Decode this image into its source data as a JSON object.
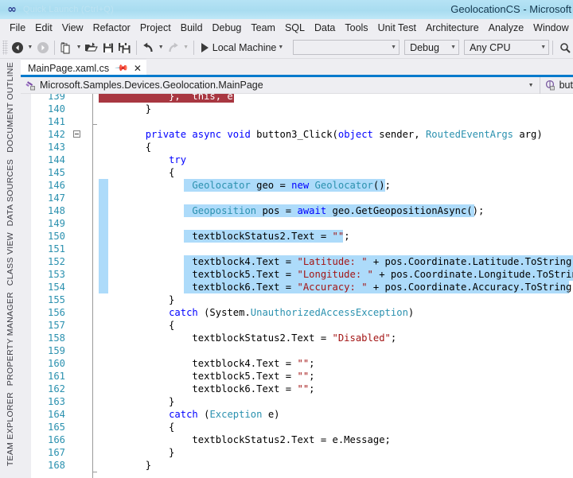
{
  "window": {
    "title": "GeolocationCS - Microsoft",
    "logo_icon": "visual-studio-infinity-logo",
    "quick_launch_placeholder": "Quick Launch (Ctrl+Q)"
  },
  "menu": {
    "items": [
      "File",
      "Edit",
      "View",
      "Refactor",
      "Project",
      "Build",
      "Debug",
      "Team",
      "SQL",
      "Data",
      "Tools",
      "Unit Test",
      "Architecture",
      "Analyze",
      "Window"
    ]
  },
  "toolbar": {
    "icons": [
      "navigate-back-icon",
      "navigate-forward-icon",
      "new-item-icon",
      "open-file-icon",
      "save-icon",
      "save-all-icon",
      "undo-icon",
      "redo-icon"
    ],
    "run_label": "Local Machine",
    "run_icon": "play-icon",
    "target_device_value": "",
    "configuration_value": "Debug",
    "platform_value": "Any CPU",
    "find_icon": "find-in-files-icon"
  },
  "left_rail": {
    "tabs": [
      "DOCUMENT OUTLINE",
      "DATA SOURCES",
      "CLASS VIEW",
      "PROPERTY MANAGER",
      "TEAM EXPLORER"
    ]
  },
  "document_tab": {
    "label": "MainPage.xaml.cs",
    "pin_icon": "pin-icon",
    "close_icon": "close-icon"
  },
  "navbar": {
    "type_icon": "class-members-icon",
    "type_value": "Microsoft.Samples.Devices.Geolocation.MainPage",
    "member_icon": "method-icon",
    "member_value": "but",
    "caret_icon": "chevron-down-icon"
  },
  "colors": {
    "accent": "#007acc",
    "selection": "#addbfa",
    "breakpoint_line": "#a83741",
    "line_number": "#2b91af",
    "keyword": "#0000ff",
    "type": "#2b91af",
    "string": "#a31515",
    "titlebar": "#a8dcf0",
    "chrome": "#eeeef2"
  },
  "editor": {
    "first_line": 139,
    "lines": [
      {
        "n": 139,
        "sel": "red",
        "redx": 98,
        "redw": 170,
        "tokens": [
          {
            "t": "            },  this, e);",
            "c": "redtext"
          }
        ]
      },
      {
        "n": 140,
        "tokens": [
          {
            "t": "        }",
            "c": "pln"
          }
        ]
      },
      {
        "n": 141,
        "tokens": [
          {
            "t": "",
            "c": "pln"
          }
        ]
      },
      {
        "n": 142,
        "collapse": true,
        "tokens": [
          {
            "t": "        ",
            "c": "pln"
          },
          {
            "t": "private",
            "c": "kw"
          },
          {
            "t": " ",
            "c": "pln"
          },
          {
            "t": "async",
            "c": "kw"
          },
          {
            "t": " ",
            "c": "pln"
          },
          {
            "t": "void",
            "c": "kw"
          },
          {
            "t": " button3_Click(",
            "c": "pln"
          },
          {
            "t": "object",
            "c": "kw"
          },
          {
            "t": " sender, ",
            "c": "pln"
          },
          {
            "t": "RoutedEventArgs",
            "c": "typ"
          },
          {
            "t": " arg)",
            "c": "pln"
          }
        ]
      },
      {
        "n": 143,
        "tokens": [
          {
            "t": "        {",
            "c": "pln"
          }
        ]
      },
      {
        "n": 144,
        "tokens": [
          {
            "t": "            ",
            "c": "pln"
          },
          {
            "t": "try",
            "c": "kw"
          }
        ]
      },
      {
        "n": 145,
        "tokens": [
          {
            "t": "            {",
            "c": "pln"
          }
        ]
      },
      {
        "n": 146,
        "sel": "part",
        "selx": 205,
        "selw": 253,
        "tokens": [
          {
            "t": "                ",
            "c": "pln"
          },
          {
            "t": "Geolocator",
            "c": "typ"
          },
          {
            "t": " geo = ",
            "c": "pln"
          },
          {
            "t": "new",
            "c": "kw"
          },
          {
            "t": " ",
            "c": "pln"
          },
          {
            "t": "Geolocator",
            "c": "typ"
          },
          {
            "t": "();",
            "c": "pln"
          }
        ]
      },
      {
        "n": 147,
        "sel": "margin",
        "tokens": [
          {
            "t": "",
            "c": "pln"
          }
        ]
      },
      {
        "n": 148,
        "sel": "part",
        "selx": 205,
        "selw": 365,
        "tokens": [
          {
            "t": "                ",
            "c": "pln"
          },
          {
            "t": "Geoposition",
            "c": "typ"
          },
          {
            "t": " pos = ",
            "c": "pln"
          },
          {
            "t": "await",
            "c": "kw"
          },
          {
            "t": " geo.GetGeopositionAsync();",
            "c": "pln"
          }
        ]
      },
      {
        "n": 149,
        "sel": "margin",
        "tokens": [
          {
            "t": "",
            "c": "pln"
          }
        ]
      },
      {
        "n": 150,
        "sel": "part",
        "selx": 205,
        "selw": 200,
        "tokens": [
          {
            "t": "                textblockStatus2.Text = ",
            "c": "pln"
          },
          {
            "t": "\"\"",
            "c": "str"
          },
          {
            "t": ";",
            "c": "pln"
          }
        ]
      },
      {
        "n": 151,
        "sel": "margin",
        "tokens": [
          {
            "t": "",
            "c": "pln"
          }
        ]
      },
      {
        "n": 152,
        "sel": "part",
        "selx": 205,
        "selw": 507,
        "tokens": [
          {
            "t": "                textblock4.Text = ",
            "c": "pln"
          },
          {
            "t": "\"Latitude: \"",
            "c": "str"
          },
          {
            "t": " + pos.Coordinate.Latitude.ToString();",
            "c": "pln"
          }
        ]
      },
      {
        "n": 153,
        "sel": "part",
        "selx": 205,
        "selw": 514,
        "tokens": [
          {
            "t": "                textblock5.Text = ",
            "c": "pln"
          },
          {
            "t": "\"Longitude: \"",
            "c": "str"
          },
          {
            "t": " + pos.Coordinate.Longitude.ToString();",
            "c": "pln"
          }
        ]
      },
      {
        "n": 154,
        "sel": "part",
        "selx": 205,
        "selw": 484,
        "tokens": [
          {
            "t": "                textblock6.Text = ",
            "c": "pln"
          },
          {
            "t": "\"Accuracy: \"",
            "c": "str"
          },
          {
            "t": " + pos.Coordinate.Accuracy.ToString();",
            "c": "pln"
          }
        ]
      },
      {
        "n": 155,
        "tokens": [
          {
            "t": "            }",
            "c": "pln"
          }
        ]
      },
      {
        "n": 156,
        "tokens": [
          {
            "t": "            ",
            "c": "pln"
          },
          {
            "t": "catch",
            "c": "kw"
          },
          {
            "t": " (System.",
            "c": "pln"
          },
          {
            "t": "UnauthorizedAccessException",
            "c": "typ"
          },
          {
            "t": ")",
            "c": "pln"
          }
        ]
      },
      {
        "n": 157,
        "tokens": [
          {
            "t": "            {",
            "c": "pln"
          }
        ]
      },
      {
        "n": 158,
        "tokens": [
          {
            "t": "                textblockStatus2.Text = ",
            "c": "pln"
          },
          {
            "t": "\"Disabled\"",
            "c": "str"
          },
          {
            "t": ";",
            "c": "pln"
          }
        ]
      },
      {
        "n": 159,
        "tokens": [
          {
            "t": "",
            "c": "pln"
          }
        ]
      },
      {
        "n": 160,
        "tokens": [
          {
            "t": "                textblock4.Text = ",
            "c": "pln"
          },
          {
            "t": "\"\"",
            "c": "str"
          },
          {
            "t": ";",
            "c": "pln"
          }
        ]
      },
      {
        "n": 161,
        "tokens": [
          {
            "t": "                textblock5.Text = ",
            "c": "pln"
          },
          {
            "t": "\"\"",
            "c": "str"
          },
          {
            "t": ";",
            "c": "pln"
          }
        ]
      },
      {
        "n": 162,
        "tokens": [
          {
            "t": "                textblock6.Text = ",
            "c": "pln"
          },
          {
            "t": "\"\"",
            "c": "str"
          },
          {
            "t": ";",
            "c": "pln"
          }
        ]
      },
      {
        "n": 163,
        "tokens": [
          {
            "t": "            }",
            "c": "pln"
          }
        ]
      },
      {
        "n": 164,
        "tokens": [
          {
            "t": "            ",
            "c": "pln"
          },
          {
            "t": "catch",
            "c": "kw"
          },
          {
            "t": " (",
            "c": "pln"
          },
          {
            "t": "Exception",
            "c": "typ"
          },
          {
            "t": " e)",
            "c": "pln"
          }
        ]
      },
      {
        "n": 165,
        "tokens": [
          {
            "t": "            {",
            "c": "pln"
          }
        ]
      },
      {
        "n": 166,
        "tokens": [
          {
            "t": "                textblockStatus2.Text = e.Message;",
            "c": "pln"
          }
        ]
      },
      {
        "n": 167,
        "tokens": [
          {
            "t": "            }",
            "c": "pln"
          }
        ]
      },
      {
        "n": 168,
        "tokens": [
          {
            "t": "        }",
            "c": "pln"
          }
        ]
      }
    ]
  }
}
